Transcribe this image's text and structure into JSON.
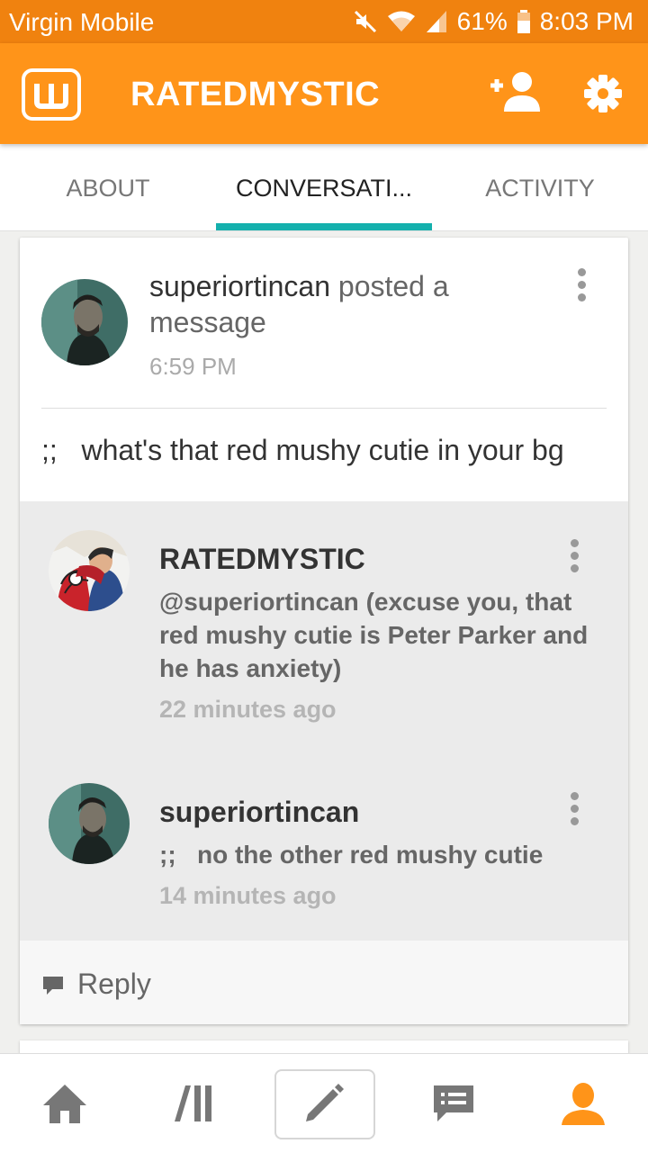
{
  "status_bar": {
    "carrier": "Virgin Mobile",
    "battery": "61%",
    "time": "8:03 PM",
    "icons": [
      "mute-icon",
      "wifi-icon",
      "signal-icon",
      "battery-icon"
    ]
  },
  "app_bar": {
    "title": "RATEDMYSTIC",
    "icons": [
      "wattpad-logo",
      "add-friend-icon",
      "settings-icon"
    ]
  },
  "tabs": [
    {
      "label": "ABOUT",
      "active": false
    },
    {
      "label": "CONVERSATI...",
      "active": true
    },
    {
      "label": "ACTIVITY",
      "active": false
    }
  ],
  "post": {
    "username": "superiortincan",
    "action": "posted a message",
    "time": "6:59 PM",
    "body": ";;   what's that red mushy cutie in your bg"
  },
  "replies": [
    {
      "username": "RATEDMYSTIC",
      "text": "@superiortincan (excuse you, that red mushy cutie is Peter Parker and he has anxiety)",
      "time": "22 minutes ago"
    },
    {
      "username": "superiortincan",
      "text": ";;   no the other red mushy cutie",
      "time": "14 minutes ago"
    }
  ],
  "reply_button": {
    "label": "Reply"
  },
  "bottom_nav": [
    "home-icon",
    "library-icon",
    "write-icon",
    "messages-icon",
    "profile-icon"
  ],
  "colors": {
    "accent": "#ff9419",
    "tab_indicator": "#14b0ad",
    "status_bar": "#f0820f"
  }
}
